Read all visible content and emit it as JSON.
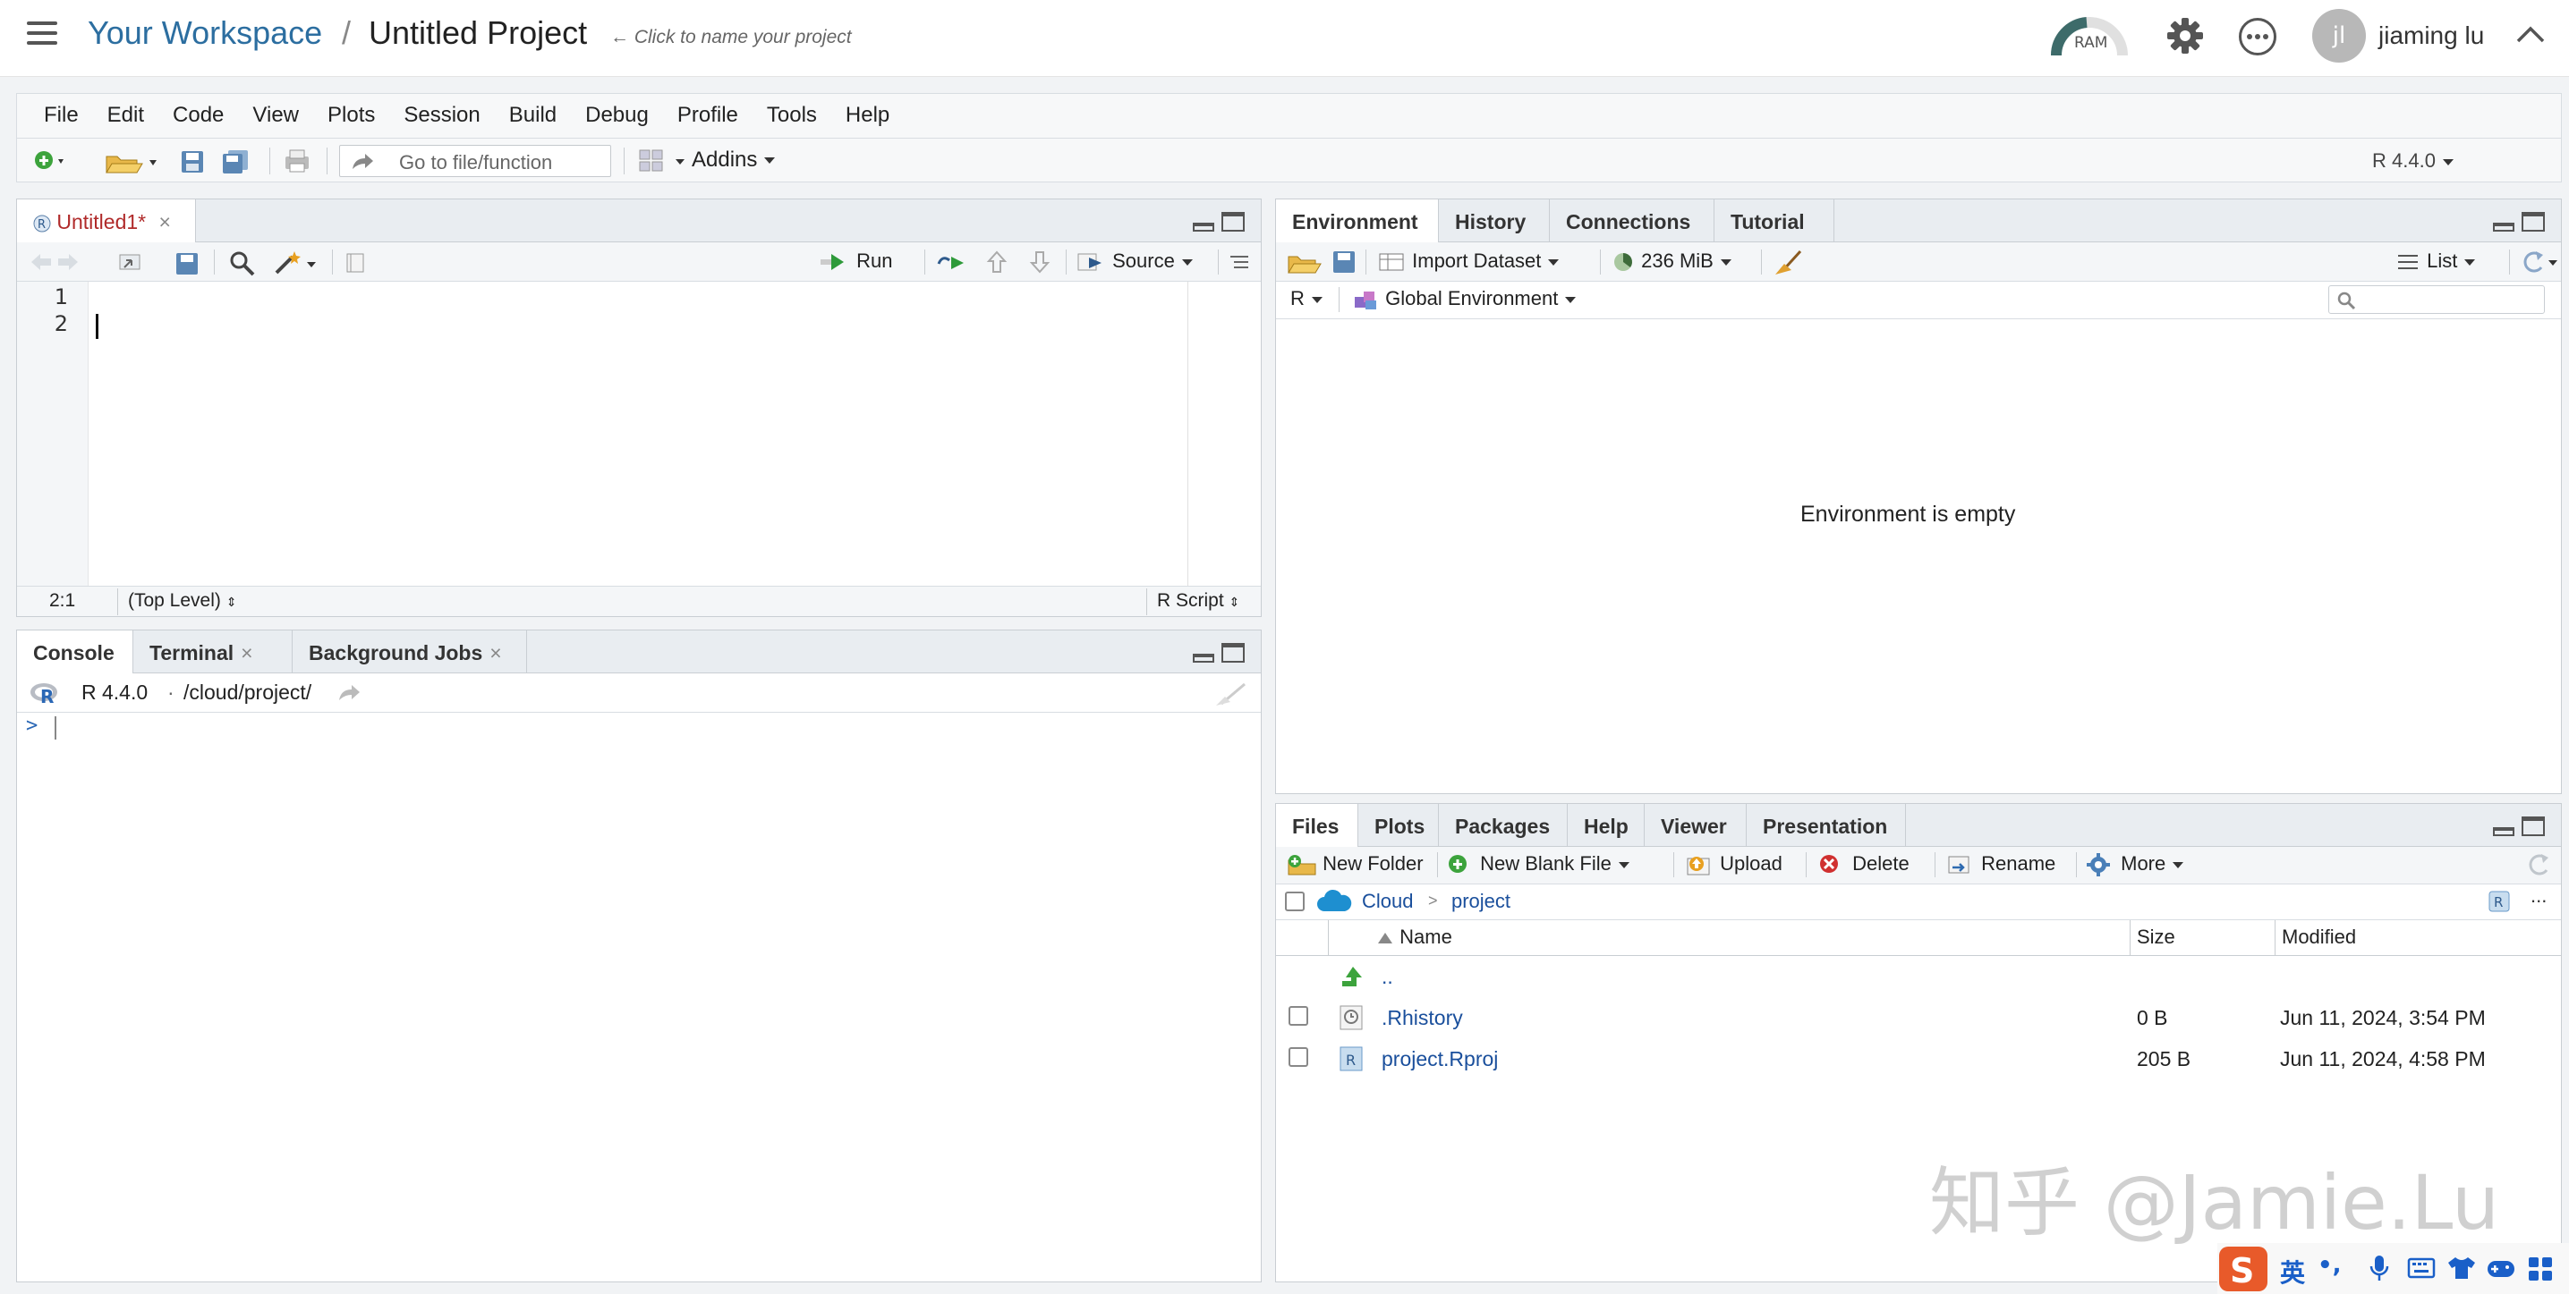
{
  "header": {
    "workspace": "Your Workspace",
    "slash": "/",
    "project": "Untitled Project",
    "hint": "← Click to name your project",
    "ram_label": "RAM",
    "user_initials": "jl",
    "user_name": "jiaming lu"
  },
  "menu": [
    "File",
    "Edit",
    "Code",
    "View",
    "Plots",
    "Session",
    "Build",
    "Debug",
    "Profile",
    "Tools",
    "Help"
  ],
  "toolbar": {
    "goto_placeholder": "Go to file/function",
    "addins": "Addins",
    "r_version": "R 4.4.0"
  },
  "editor": {
    "tab_label": "Untitled1*",
    "run_label": "Run",
    "source_label": "Source",
    "line_numbers": [
      "1",
      "2"
    ],
    "cursor_pos": "2:1",
    "scope": "(Top Level)",
    "file_type": "R Script"
  },
  "console": {
    "tabs": [
      "Console",
      "Terminal",
      "Background Jobs"
    ],
    "r_version": "R 4.4.0",
    "dot": "·",
    "path": "/cloud/project/",
    "prompt": ">"
  },
  "environment": {
    "tabs": [
      "Environment",
      "History",
      "Connections",
      "Tutorial"
    ],
    "import_dataset": "Import Dataset",
    "memory": "236 MiB",
    "list_label": "List",
    "r_lang": "R",
    "scope": "Global Environment",
    "empty_message": "Environment is empty"
  },
  "files": {
    "tabs": [
      "Files",
      "Plots",
      "Packages",
      "Help",
      "Viewer",
      "Presentation"
    ],
    "new_folder": "New Folder",
    "new_blank_file": "New Blank File",
    "upload": "Upload",
    "delete": "Delete",
    "rename": "Rename",
    "more": "More",
    "path_root": "Cloud",
    "path_sep": ">",
    "path_child": "project",
    "ellipsis": "...",
    "columns": {
      "name": "Name",
      "size": "Size",
      "modified": "Modified"
    },
    "parent_dir": "..",
    "rows": [
      {
        "name": ".Rhistory",
        "size": "0 B",
        "modified": "Jun 11, 2024, 3:54 PM"
      },
      {
        "name": "project.Rproj",
        "size": "205 B",
        "modified": "Jun 11, 2024, 4:58 PM"
      }
    ]
  },
  "watermark": "知乎 @Jamie.Lu",
  "ime": {
    "lang": "英",
    "punct": "•,"
  },
  "colors": {
    "accent_blue": "#2c6ea0",
    "link_blue": "#1a4f9c",
    "tab_red": "#b02a2a",
    "green": "#2e9a3a"
  }
}
